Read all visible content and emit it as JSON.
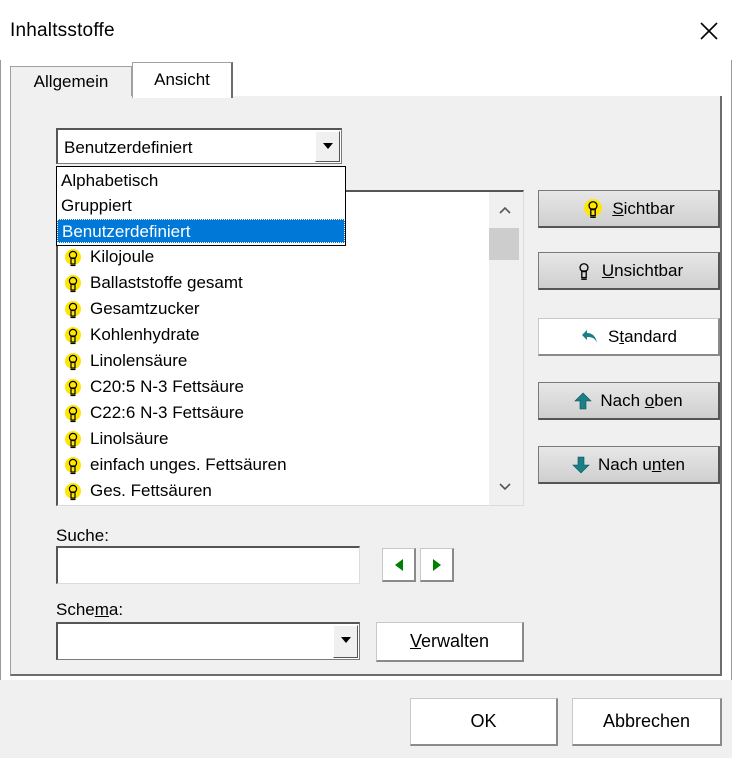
{
  "window": {
    "title": "Inhaltsstoffe"
  },
  "tabs": [
    {
      "label": "Allgemein"
    },
    {
      "label": "Ansicht"
    }
  ],
  "sort_combo": {
    "value": "Benutzerdefiniert",
    "options": [
      "Alphabetisch",
      "Gruppiert",
      "Benutzerdefiniert"
    ]
  },
  "list": {
    "items": [
      "Kilojoule",
      "Ballaststoffe gesamt",
      "Gesamtzucker",
      "Kohlenhydrate",
      "Linolensäure",
      "C20:5 N-3 Fettsäure",
      "C22:6 N-3 Fettsäure",
      "Linolsäure",
      "einfach unges. Fettsäuren",
      "Ges. Fettsäuren"
    ]
  },
  "side_buttons": {
    "visible": {
      "pre": "",
      "mn": "S",
      "post": "ichtbar"
    },
    "invisible": {
      "pre": "",
      "mn": "U",
      "post": "nsichtbar"
    },
    "standard": {
      "pre": "S",
      "mn": "t",
      "post": "andard"
    },
    "up": {
      "pre": "Nach ",
      "mn": "o",
      "post": "ben"
    },
    "down": {
      "pre": "Nach u",
      "mn": "n",
      "post": "ten"
    }
  },
  "search": {
    "label": "Suche:",
    "value": ""
  },
  "schema": {
    "label_pre": "Sche",
    "label_mn": "m",
    "label_post": "a:",
    "value": ""
  },
  "manage_button": {
    "pre": "",
    "mn": "V",
    "post": "erwalten"
  },
  "footer": {
    "ok": "OK",
    "cancel": "Abbrechen"
  },
  "colors": {
    "selection": "#0078d7",
    "bulb": "#ffe600",
    "arrow_green": "#008000",
    "accent_teal": "#1a7f86"
  }
}
